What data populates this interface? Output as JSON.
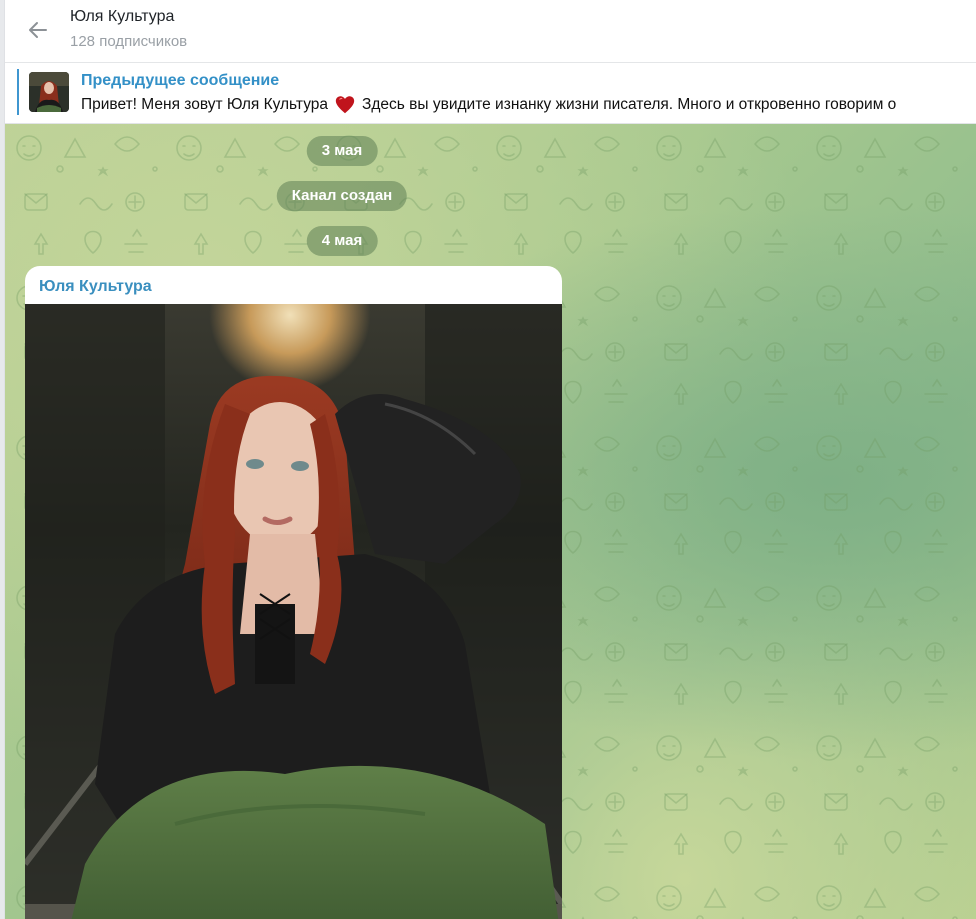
{
  "header": {
    "title": "Юля Культура",
    "subtitle": "128 подписчиков",
    "back_icon": "arrow-left-icon"
  },
  "pinned": {
    "title": "Предыдущее сообщение",
    "text_before": "Привет! Меня зовут Юля Культура",
    "text_after": "Здесь вы увидите изнанку жизни писателя.  Много и откровенно говорим о",
    "emoji_icon": "red-heart-icon",
    "accent_color": "#3f96d0"
  },
  "chat": {
    "dates": [
      {
        "label": "3 мая"
      },
      {
        "label": "Канал создан"
      },
      {
        "label": "4 мая"
      }
    ],
    "message": {
      "author": "Юля Культура",
      "author_color": "#3a8fbf"
    },
    "pill_color": "#5e8056"
  }
}
